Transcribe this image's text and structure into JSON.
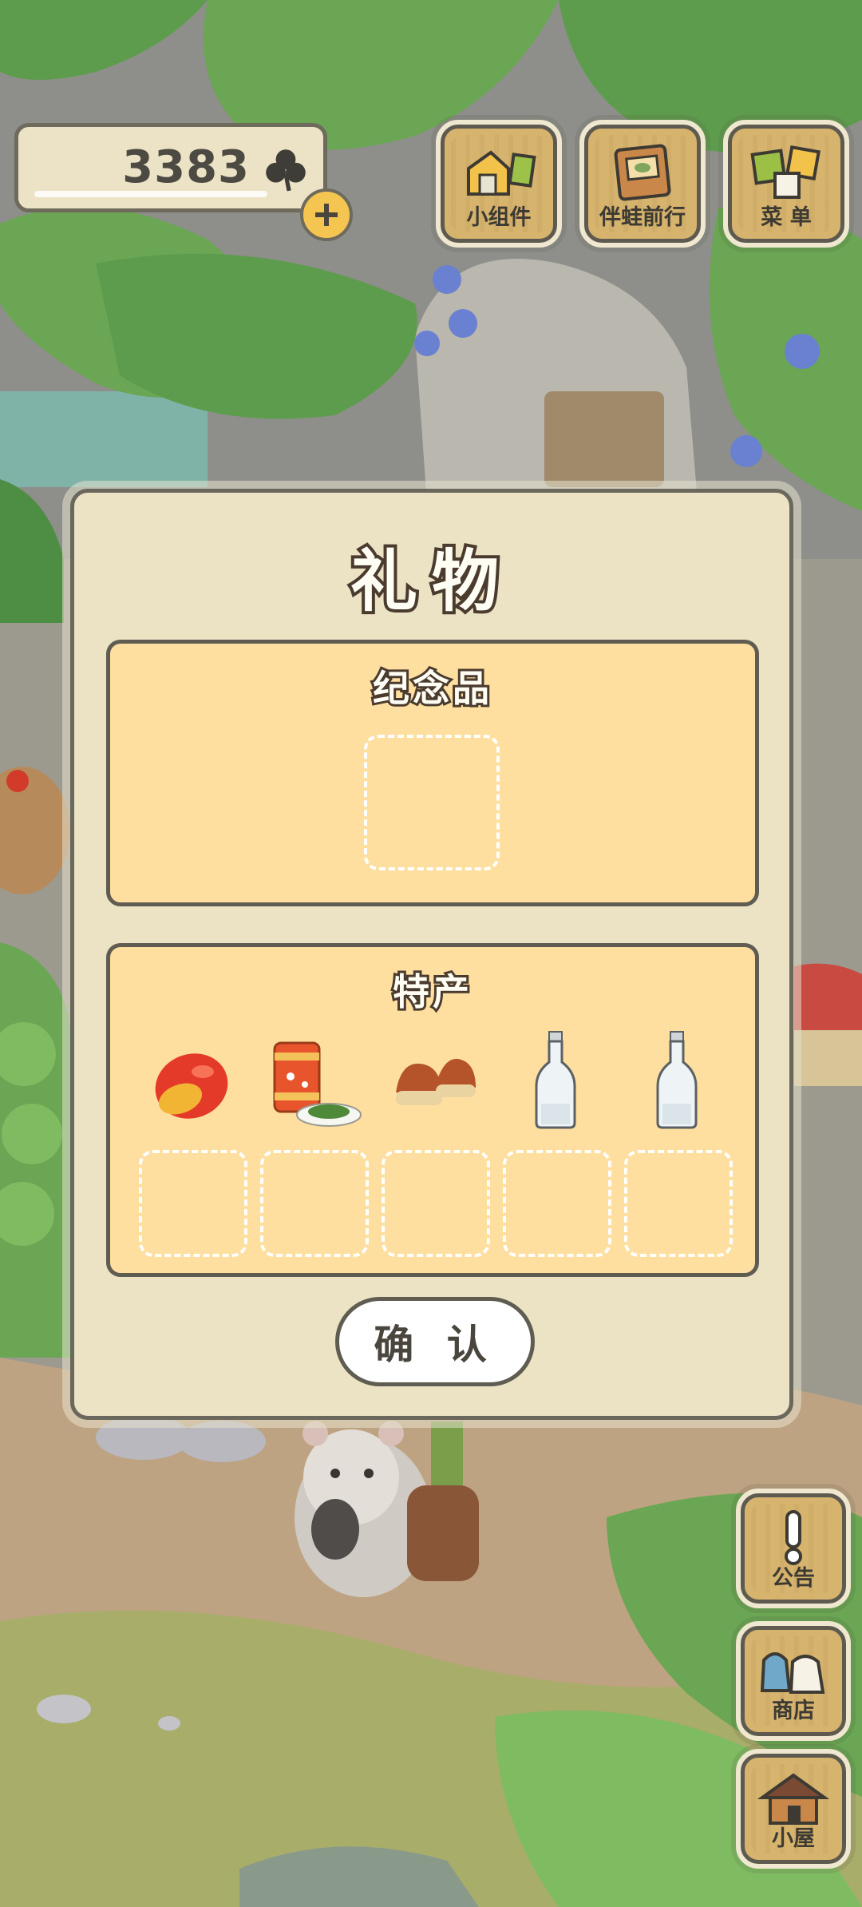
{
  "hud": {
    "clover_count": "3383",
    "top_buttons": [
      {
        "label": "小组件",
        "icon": "widget-icon"
      },
      {
        "label": "伴蛙前行",
        "icon": "journey-book-icon"
      },
      {
        "label": "菜 单",
        "icon": "menu-icon"
      }
    ],
    "side_buttons": [
      {
        "label": "公告",
        "icon": "notice-exclamation-icon"
      },
      {
        "label": "商店",
        "icon": "shop-bags-icon"
      },
      {
        "label": "小屋",
        "icon": "house-icon"
      }
    ]
  },
  "gift_dialog": {
    "title": "礼物",
    "souvenir_section": {
      "title": "纪念品",
      "slots": 1
    },
    "specialty_section": {
      "title": "特产",
      "items": [
        "mango-icon",
        "canned-food-icon",
        "chestnuts-icon",
        "bottle-icon",
        "bottle-icon"
      ],
      "slots": 5
    },
    "confirm_label": "确 认"
  },
  "colors": {
    "panel_fill": "#ffdf9f",
    "dialog_fill": "#ece2c4",
    "outline": "#5f5d52",
    "button_wood": "#d6b46e",
    "clover_yellow": "#f4c550"
  }
}
